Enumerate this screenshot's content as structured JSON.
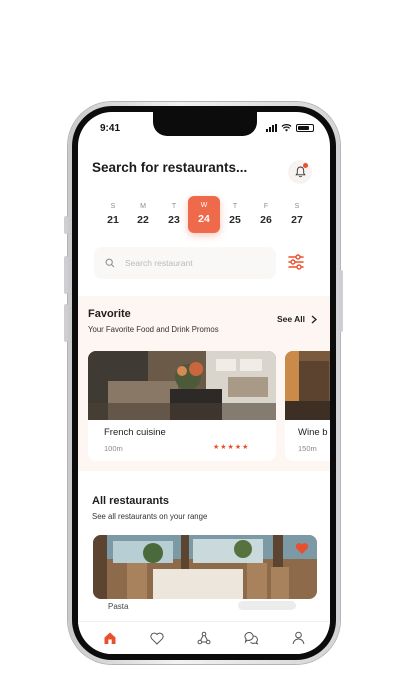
{
  "status": {
    "time": "9:41"
  },
  "header": {
    "title": "Search for restaurants..."
  },
  "dates": [
    {
      "dow": "S",
      "num": "21",
      "active": false
    },
    {
      "dow": "M",
      "num": "22",
      "active": false
    },
    {
      "dow": "T",
      "num": "23",
      "active": false
    },
    {
      "dow": "W",
      "num": "24",
      "active": true
    },
    {
      "dow": "T",
      "num": "25",
      "active": false
    },
    {
      "dow": "F",
      "num": "26",
      "active": false
    },
    {
      "dow": "S",
      "num": "27",
      "active": false
    }
  ],
  "search": {
    "placeholder": "Search restaurant",
    "value": ""
  },
  "favorite": {
    "title": "Favorite",
    "subtitle": "Your Favorite Food and Drink Promos",
    "see_all": "See All",
    "cards": [
      {
        "name": "French cuisine",
        "distance": "100m",
        "stars": "★★★★★"
      },
      {
        "name": "Wine b",
        "distance": "150m"
      }
    ]
  },
  "all_restaurants": {
    "title": "All restaurants",
    "subtitle": "See all  restaurants on your range",
    "peek_name": "Pasta"
  },
  "colors": {
    "accent": "#ef6a4a",
    "section_bg": "#fdf6f2"
  },
  "tabs": [
    "home-icon",
    "heart-icon",
    "share-nodes-icon",
    "chat-icon",
    "profile-icon"
  ]
}
